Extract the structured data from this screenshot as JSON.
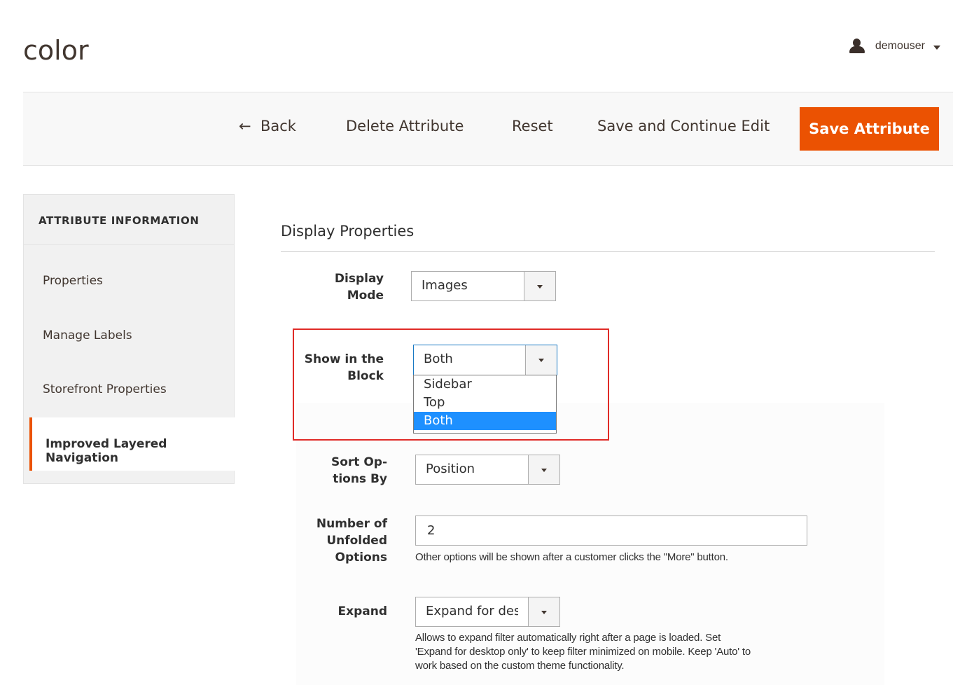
{
  "header": {
    "page_title": "color",
    "user": {
      "name": "demouser",
      "icon": "user-icon"
    }
  },
  "actions": {
    "back_arrow": "←",
    "back_label": "Back",
    "delete_label": "Delete Attribute",
    "reset_label": "Reset",
    "save_continue_label": "Save and Continue Edit",
    "save_label": "Save Attribute"
  },
  "sidebar": {
    "title": "ATTRIBUTE INFORMATION",
    "items": [
      {
        "label": "Properties"
      },
      {
        "label": "Manage Labels"
      },
      {
        "label": "Storefront Properties"
      },
      {
        "label": "Improved Layered Navigation",
        "active": true
      }
    ]
  },
  "section": {
    "title": "Display Properties"
  },
  "fields": {
    "display_mode": {
      "label_line1": "Display",
      "label_line2": "Mode",
      "value": "Images"
    },
    "show_in_block": {
      "label_line1": "Show in the",
      "label_line2": "Block",
      "value": "Both",
      "options": [
        "Sidebar",
        "Top",
        "Both"
      ],
      "selected_index": 2
    },
    "sort_options": {
      "label_line1": "Sort Op-",
      "label_line2": "tions By",
      "value": "Position"
    },
    "unfolded_options": {
      "label_line1": "Number of",
      "label_line2": "Unfolded",
      "label_line3": "Options",
      "value": "2",
      "note": "Other options will be shown after a customer clicks the \"More\" button."
    },
    "expand": {
      "label": "Expand",
      "value": "Expand for desktop only",
      "note_line1": "Allows to expand filter automatically right after a page is loaded. Set",
      "note_line2": "'Expand for desktop only' to keep filter minimized on mobile. Keep 'Auto' to",
      "note_line3": "work based on the custom theme functionality."
    }
  },
  "colors": {
    "accent": "#eb5202",
    "highlight_border": "#e02b27",
    "selected_option": "#1e90ff"
  }
}
